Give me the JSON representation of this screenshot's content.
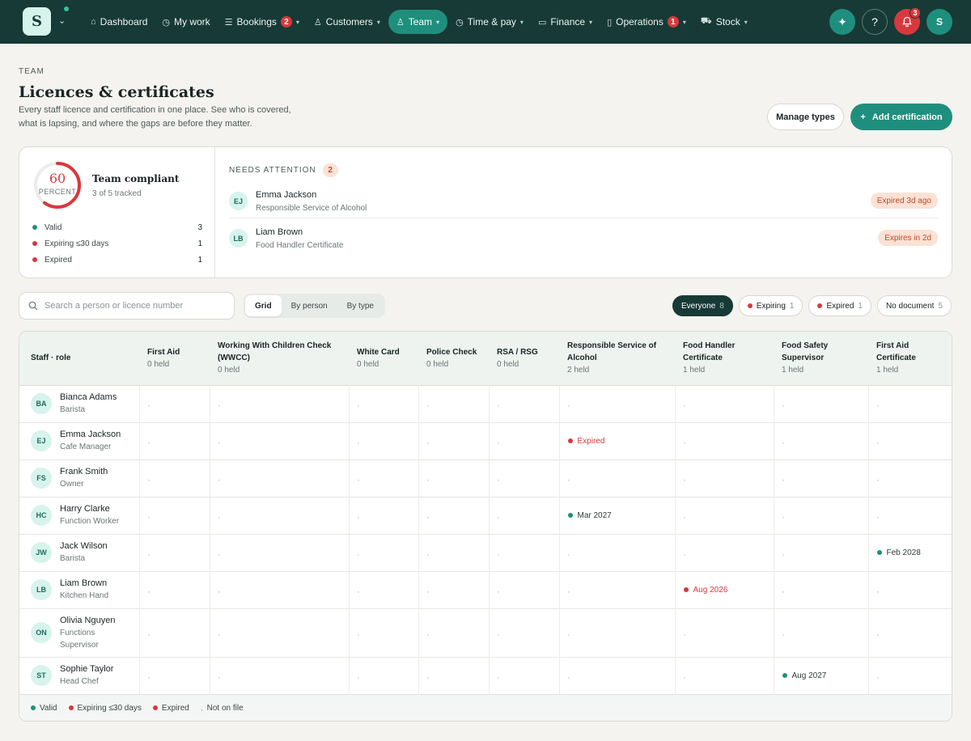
{
  "colors": {
    "valid": "#1f8f7d",
    "expiring": "#d8383d",
    "expired": "#d8383d",
    "dark": "#173a36"
  },
  "topbar": {
    "logo_letter": "S",
    "nav": [
      {
        "label": "Dashboard",
        "icon": "home-icon",
        "glyph": "⌂",
        "badge": "",
        "chevron": false,
        "active": false
      },
      {
        "label": "My work",
        "icon": "clock-icon",
        "glyph": "◷",
        "badge": "",
        "chevron": false,
        "active": false
      },
      {
        "label": "Bookings",
        "icon": "list-icon",
        "glyph": "☰",
        "badge": "2",
        "chevron": true,
        "active": false
      },
      {
        "label": "Customers",
        "icon": "users-icon",
        "glyph": "♙",
        "badge": "",
        "chevron": true,
        "active": false
      },
      {
        "label": "Team",
        "icon": "team-icon",
        "glyph": "♙",
        "badge": "",
        "chevron": true,
        "active": true
      },
      {
        "label": "Time & pay",
        "icon": "clock-icon",
        "glyph": "◷",
        "badge": "",
        "chevron": true,
        "active": false
      },
      {
        "label": "Finance",
        "icon": "card-icon",
        "glyph": "▭",
        "badge": "",
        "chevron": true,
        "active": false
      },
      {
        "label": "Operations",
        "icon": "clipboard-icon",
        "glyph": "▯",
        "badge": "1",
        "chevron": true,
        "active": false
      },
      {
        "label": "Stock",
        "icon": "cart-icon",
        "glyph": "⛟",
        "badge": "",
        "chevron": true,
        "active": false
      }
    ],
    "notifications_count": "3",
    "avatar_initial": "S"
  },
  "header": {
    "eyebrow": "TEAM",
    "title": "Licences & certificates",
    "description": "Every staff licence and certification in one place. See who is covered, what is lapsing, and where the gaps are before they matter.",
    "manage_label": "Manage types",
    "add_label": "Add certification"
  },
  "summary": {
    "percent": 60,
    "percent_label": "60",
    "percent_unit": "PERCENT",
    "title": "Team compliant",
    "subtitle": "3 of 5 tracked",
    "stats": [
      {
        "label": "Valid",
        "count": "3",
        "color": "#1f8f7d"
      },
      {
        "label": "Expiring ≤30 days",
        "count": "1",
        "color": "#d8383d"
      },
      {
        "label": "Expired",
        "count": "1",
        "color": "#d8383d"
      }
    ],
    "attention_title": "NEEDS ATTENTION",
    "attention_count": "2",
    "attention": [
      {
        "initials": "EJ",
        "name": "Emma Jackson",
        "role": "Responsible Service of Alcohol",
        "badge": "Expired 3d ago"
      },
      {
        "initials": "LB",
        "name": "Liam Brown",
        "role": "Food Handler Certificate",
        "badge": "Expires in 2d"
      }
    ]
  },
  "search": {
    "placeholder": "Search a person or licence number",
    "value": ""
  },
  "views": [
    {
      "label": "Grid",
      "active": true
    },
    {
      "label": "By person",
      "active": false
    },
    {
      "label": "By type",
      "active": false
    }
  ],
  "filters": [
    {
      "label": "Everyone",
      "count": "8",
      "active": true,
      "dot": ""
    },
    {
      "label": "Expiring",
      "count": "1",
      "active": false,
      "dot": "#d8383d"
    },
    {
      "label": "Expired",
      "count": "1",
      "active": false,
      "dot": "#d8383d"
    },
    {
      "label": "No document",
      "count": "5",
      "active": false,
      "dot": ""
    }
  ],
  "grid": {
    "staff_header": "Staff · role",
    "columns": [
      {
        "label": "First Aid",
        "held": "0 held"
      },
      {
        "label": "Working With Children Check (WWCC)",
        "held": "0 held"
      },
      {
        "label": "White Card",
        "held": "0 held"
      },
      {
        "label": "Police Check",
        "held": "0 held"
      },
      {
        "label": "RSA / RSG",
        "held": "0 held"
      },
      {
        "label": "Responsible Service of Alcohol",
        "held": "2 held"
      },
      {
        "label": "Food Handler Certificate",
        "held": "1 held"
      },
      {
        "label": "Food Safety Supervisor",
        "held": "1 held"
      },
      {
        "label": "First Aid Certificate",
        "held": "1 held"
      }
    ],
    "empty_mark": ",",
    "rows": [
      {
        "initials": "BA",
        "name": "Bianca Adams",
        "role": "Barista",
        "cells": {}
      },
      {
        "initials": "EJ",
        "name": "Emma Jackson",
        "role": "Cafe Manager",
        "cells": {
          "5": {
            "status": "expired",
            "text": "Expired"
          }
        }
      },
      {
        "initials": "FS",
        "name": "Frank Smith",
        "role": "Owner",
        "cells": {}
      },
      {
        "initials": "HC",
        "name": "Harry Clarke",
        "role": "Function Worker",
        "cells": {
          "5": {
            "status": "valid",
            "text": "Mar 2027"
          }
        }
      },
      {
        "initials": "JW",
        "name": "Jack Wilson",
        "role": "Barista",
        "cells": {
          "8": {
            "status": "valid",
            "text": "Feb 2028"
          }
        }
      },
      {
        "initials": "LB",
        "name": "Liam Brown",
        "role": "Kitchen Hand",
        "cells": {
          "6": {
            "status": "expiring",
            "text": "Aug 2026"
          }
        }
      },
      {
        "initials": "ON",
        "name": "Olivia Nguyen",
        "role": "Functions Supervisor",
        "cells": {}
      },
      {
        "initials": "ST",
        "name": "Sophie Taylor",
        "role": "Head Chef",
        "cells": {
          "7": {
            "status": "valid",
            "text": "Aug 2027"
          }
        }
      }
    ]
  },
  "legend": [
    {
      "label": "Valid",
      "color": "#1f8f7d",
      "mark": ""
    },
    {
      "label": "Expiring ≤30 days",
      "color": "#d8383d",
      "mark": ""
    },
    {
      "label": "Expired",
      "color": "#d8383d",
      "mark": ""
    },
    {
      "label": "Not on file",
      "color": "",
      "mark": ","
    }
  ]
}
